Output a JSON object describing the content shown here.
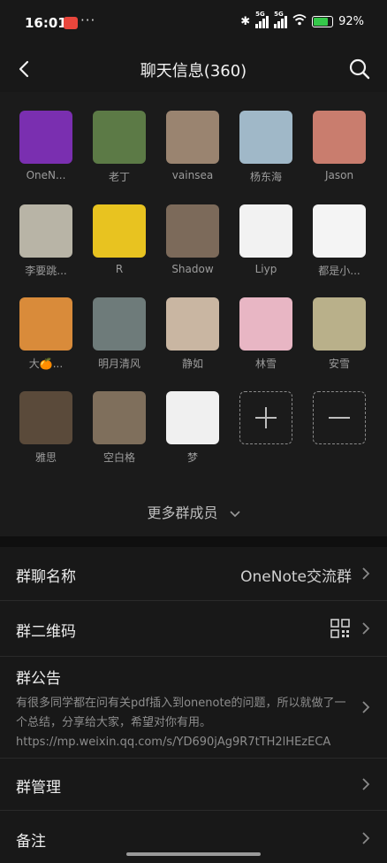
{
  "status_bar": {
    "time": "16:01",
    "dots": "···",
    "battery_percent": "92%",
    "network": "5G"
  },
  "header": {
    "title": "聊天信息(360)"
  },
  "members": [
    {
      "name": "OneN...",
      "bg": "#7a2fb0"
    },
    {
      "name": "老丁",
      "bg": "#5c7a46"
    },
    {
      "name": "vainsea",
      "bg": "#9a8470"
    },
    {
      "name": "杨东海",
      "bg": "#a0b8c8"
    },
    {
      "name": "Jason",
      "bg": "#c97d6e"
    },
    {
      "name": "李要跳...",
      "bg": "#b8b4a6"
    },
    {
      "name": "R",
      "bg": "#e8c320"
    },
    {
      "name": "Shadow",
      "bg": "#7c6a5a"
    },
    {
      "name": "Liyp",
      "bg": "#f2f2f2"
    },
    {
      "name": "都是小...",
      "bg": "#f4f4f4"
    },
    {
      "name": "大🍊...",
      "bg": "#d98b3a"
    },
    {
      "name": "明月清风",
      "bg": "#6e7b7a"
    },
    {
      "name": "静如",
      "bg": "#c9b6a2"
    },
    {
      "name": "林雪",
      "bg": "#e8b6c4"
    },
    {
      "name": "安雪",
      "bg": "#b9b08a"
    },
    {
      "name": "雅思",
      "bg": "#5a4a3a"
    },
    {
      "name": "空白格",
      "bg": "#7f6f5c"
    },
    {
      "name": "梦",
      "bg": "#f0f0f0"
    }
  ],
  "add_member_label": "+",
  "remove_member_label": "−",
  "more_members": {
    "label": "更多群成员",
    "chevron": "chevron-down-icon"
  },
  "settings": {
    "group_name": {
      "label": "群聊名称",
      "value": "OneNote交流群"
    },
    "qr_code": {
      "label": "群二维码"
    },
    "notice": {
      "label": "群公告",
      "text": "有很多同学都在问有关pdf插入到onenote的问题，所以就做了一个总结，分享给大家，希望对你有用。https://mp.weixin.qq.com/s/YD690jAg9R7tTH2lHEzECA"
    },
    "manage": {
      "label": "群管理"
    },
    "remark": {
      "label": "备注"
    }
  },
  "colors": {
    "background": "#181818",
    "separator": "#0f0f0f",
    "text_primary": "#ececec",
    "text_secondary": "#8d8d8d",
    "battery_green": "#35c84a"
  }
}
